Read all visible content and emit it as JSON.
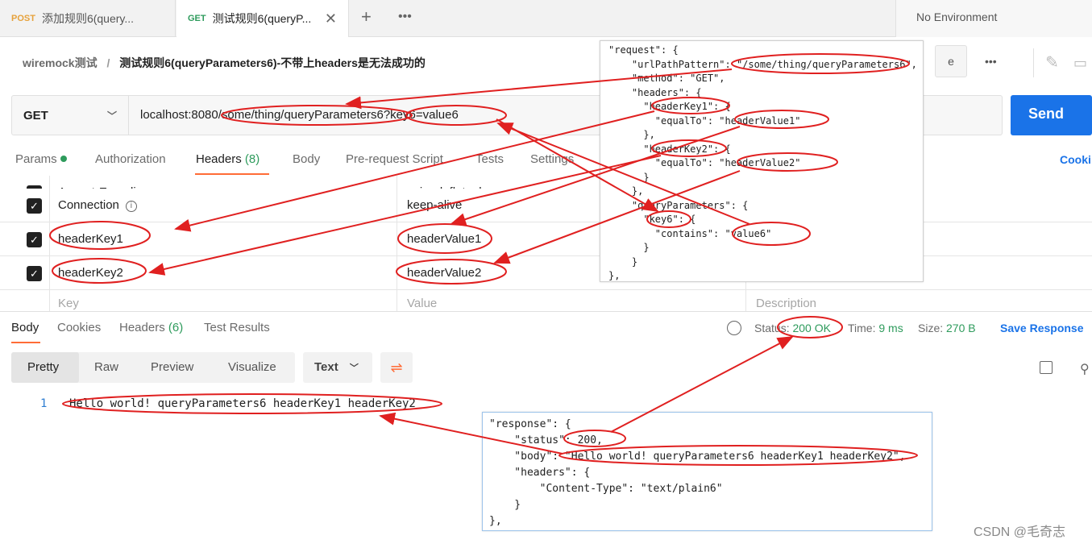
{
  "tabs": [
    {
      "method": "POST",
      "title": "添加规则6(query..."
    },
    {
      "method": "GET",
      "title": "测试规则6(queryP..."
    }
  ],
  "tabbar": {
    "add": "+",
    "more": "•••",
    "close": "✕"
  },
  "environment": "No Environment",
  "breadcrumb": {
    "parent": "wiremock测试",
    "sep": "/",
    "title": "测试规则6(queryParameters6)-不带上headers是无法成功的"
  },
  "top_actions": {
    "save_stub": "e",
    "more": "•••"
  },
  "request": {
    "method": "GET",
    "url": "localhost:8080/some/thing/queryParameters6?key6=value6",
    "send": "Send"
  },
  "request_tabs": {
    "params": "Params",
    "auth": "Authorization",
    "headers": "Headers",
    "headers_count": "(8)",
    "body": "Body",
    "prerequest": "Pre-request Script",
    "tests": "Tests",
    "settings": "Settings",
    "cookies": "Cooki"
  },
  "header_rows": [
    {
      "key": "Accept-Encoding",
      "value": "gzip, deflate, br"
    },
    {
      "key": "Connection",
      "value": "keep-alive"
    },
    {
      "key": "headerKey1",
      "value": "headerValue1"
    },
    {
      "key": "headerKey2",
      "value": "headerValue2"
    }
  ],
  "placeholders": {
    "key": "Key",
    "value": "Value",
    "description": "Description"
  },
  "response_tabs": {
    "body": "Body",
    "cookies": "Cookies",
    "headers": "Headers",
    "headers_count": "(6)",
    "tests": "Test Results"
  },
  "response_meta": {
    "status_label": "Status:",
    "status": "200 OK",
    "time_label": "Time:",
    "time": "9 ms",
    "size_label": "Size:",
    "size": "270 B",
    "save": "Save Response"
  },
  "view_modes": {
    "pretty": "Pretty",
    "raw": "Raw",
    "preview": "Preview",
    "visualize": "Visualize",
    "format": "Text"
  },
  "response_body": {
    "line": "1",
    "text": "Hello world! queryParameters6 headerKey1 headerKey2"
  },
  "req_code": [
    "\"request\": {",
    "    \"urlPathPattern\": \"/some/thing/queryParameters6\",",
    "    \"method\": \"GET\",",
    "    \"headers\": {",
    "      \"headerKey1\": {",
    "        \"equalTo\": \"headerValue1\"",
    "      },",
    "      \"headerKey2\": {",
    "        \"equalTo\": \"headerValue2\"",
    "      }",
    "    },",
    "    \"queryParameters\": {",
    "      \"key6\": {",
    "        \"contains\": \"value6\"",
    "      }",
    "    }",
    "},"
  ],
  "resp_code": [
    "\"response\": {",
    "    \"status\": 200,",
    "    \"body\": \"Hello world! queryParameters6 headerKey1 headerKey2\",",
    "    \"headers\": {",
    "        \"Content-Type\": \"text/plain6\"",
    "    }",
    "},"
  ],
  "watermark": "CSDN @毛奇志",
  "colors": {
    "accent": "#ff6c37",
    "send": "#1a73e8",
    "success": "#2e9b5c",
    "annotation": "#e02020"
  }
}
